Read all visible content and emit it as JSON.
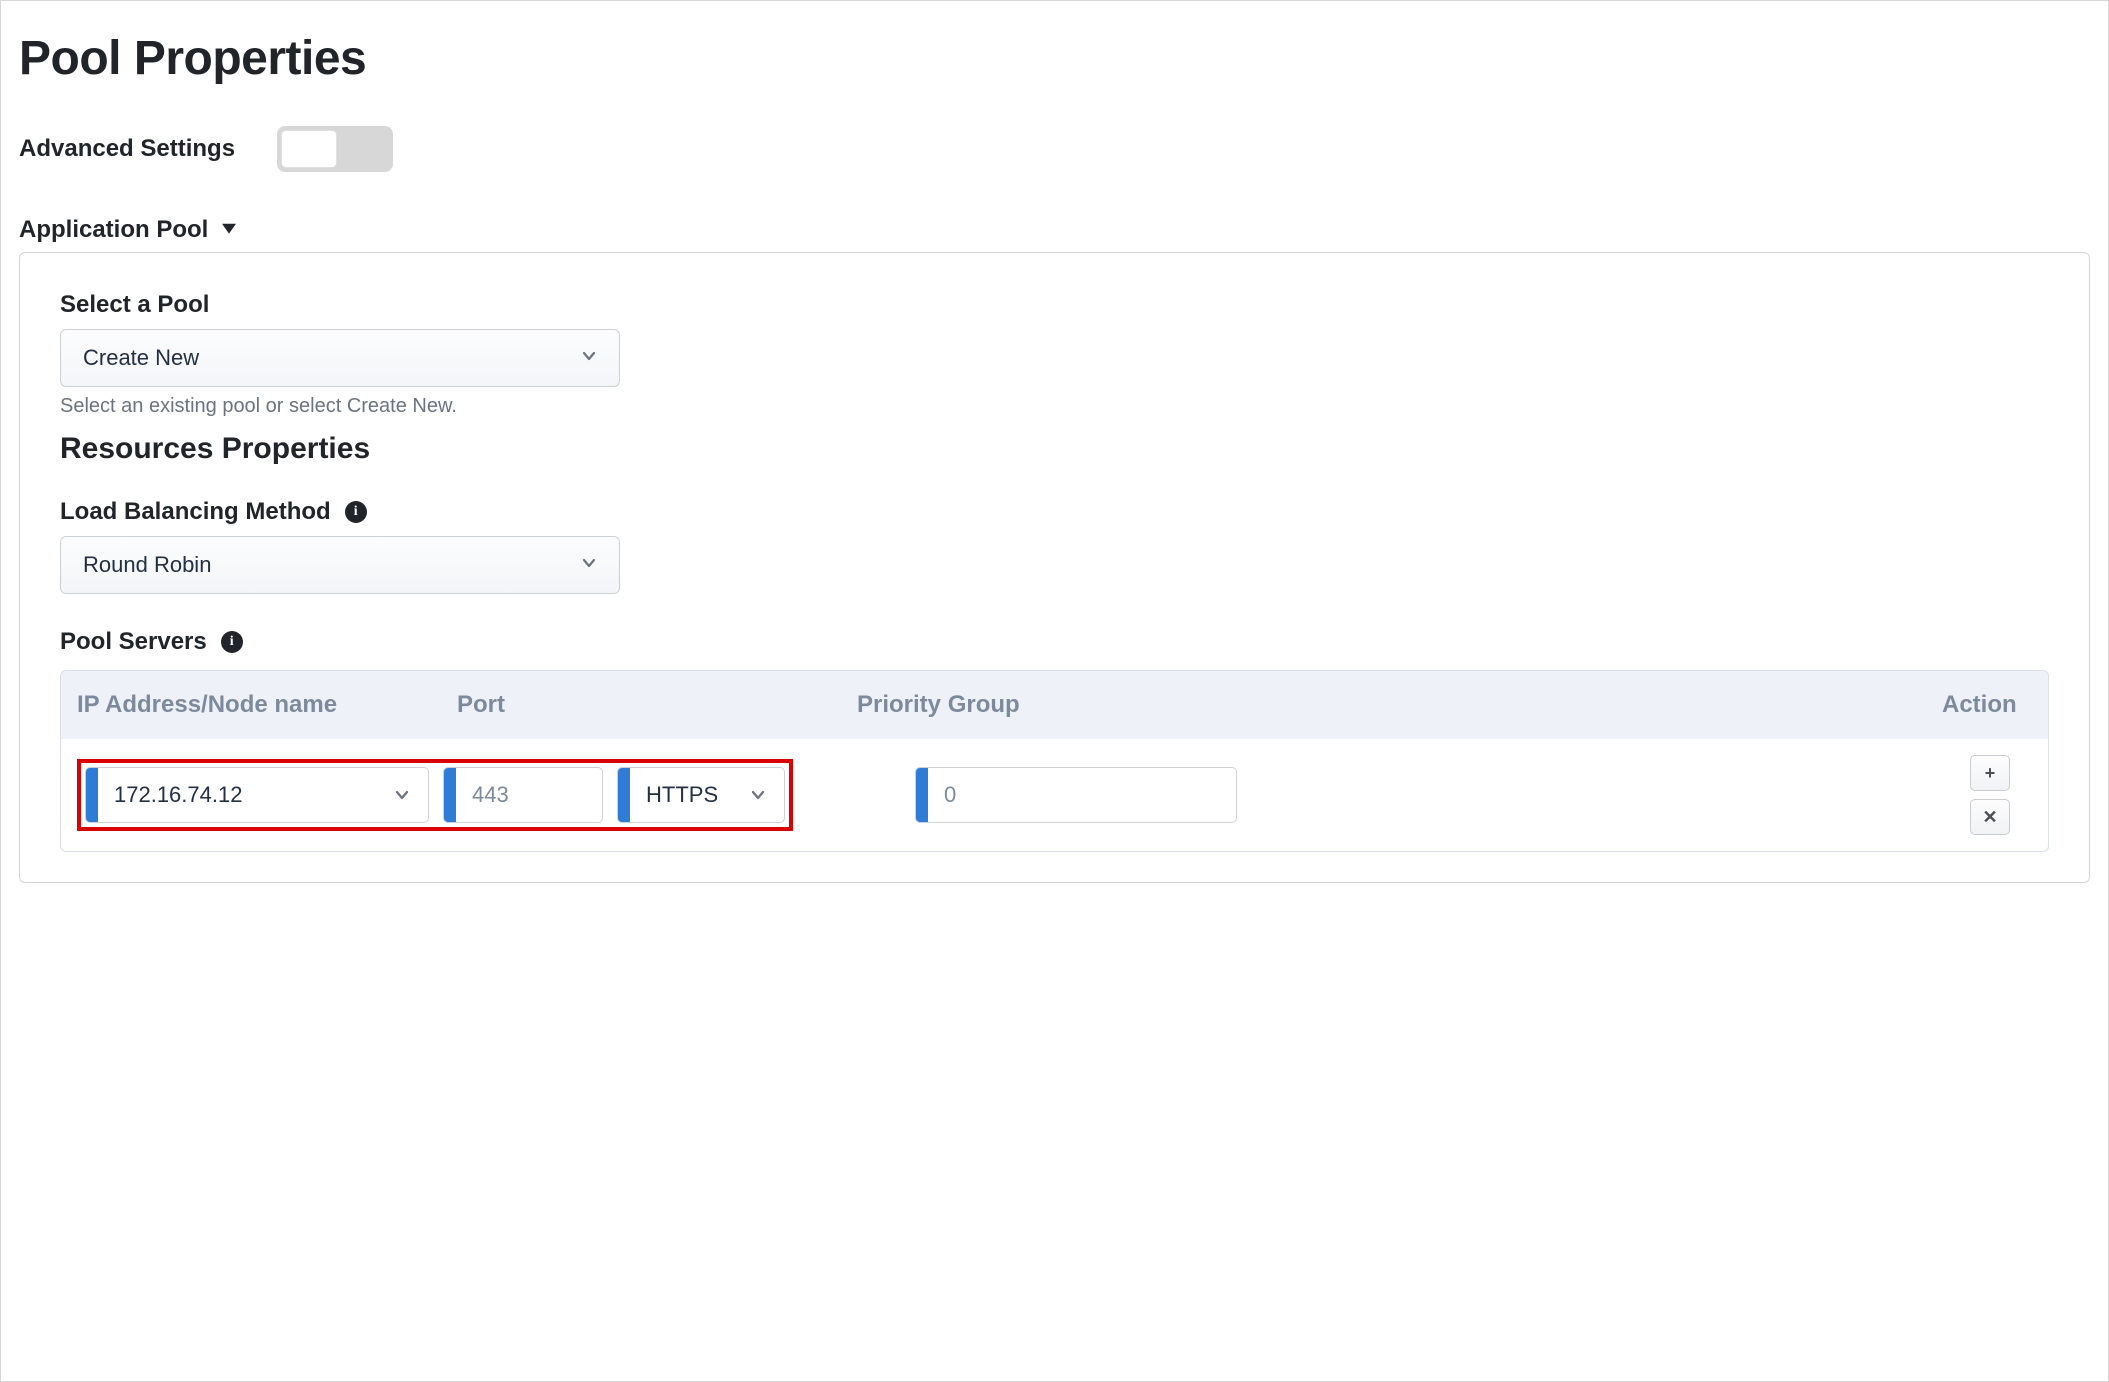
{
  "page": {
    "title": "Pool Properties"
  },
  "advanced": {
    "label": "Advanced Settings",
    "enabled": false
  },
  "section": {
    "title": "Application Pool"
  },
  "pool": {
    "select_label": "Select a Pool",
    "select_value": "Create New",
    "select_helper": "Select an existing pool or select Create New."
  },
  "resources": {
    "title": "Resources Properties",
    "lb_label": "Load Balancing Method",
    "lb_value": "Round Robin",
    "servers_label": "Pool Servers"
  },
  "table": {
    "headers": {
      "ip": "IP Address/Node name",
      "port": "Port",
      "priority": "Priority Group",
      "action": "Action"
    },
    "row": {
      "ip": "172.16.74.12",
      "port": "443",
      "protocol": "HTTPS",
      "priority": "0"
    },
    "actions": {
      "add": "+",
      "remove": "✕"
    }
  }
}
